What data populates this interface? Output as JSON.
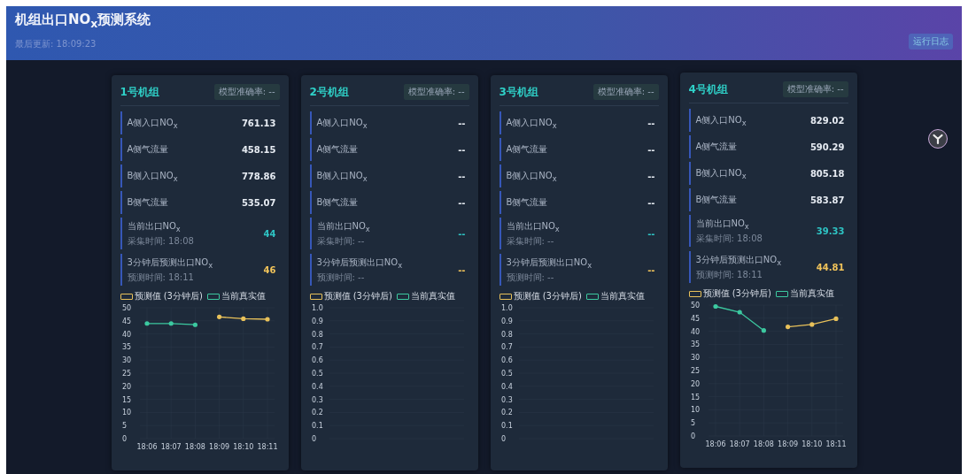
{
  "header": {
    "title": "机组出口NO$_{x}$预测系统",
    "updated": "最后更新: 18:09:23",
    "button": "运行日志"
  },
  "units": [
    {
      "name": "1号机组",
      "accuracy": "模型准确率: --",
      "rows": [
        {
          "kind": "plain",
          "label": "A侧入口NO$_{x}$",
          "value": "761.13"
        },
        {
          "kind": "plain",
          "label": "A侧气流量",
          "value": "458.15"
        },
        {
          "kind": "plain",
          "label": "B侧入口NO$_{x}$",
          "value": "778.86"
        },
        {
          "kind": "plain",
          "label": "B侧气流量",
          "value": "535.07"
        },
        {
          "kind": "current",
          "label": "当前出口NO$_{x}$",
          "sub": "采集时间: 18:08",
          "value": "44"
        },
        {
          "kind": "predicted",
          "label": "3分钟后预测出口NO$_{x}$",
          "sub": "预测时间: 18:11",
          "value": "46"
        }
      ],
      "chart_data": {
        "type": "line",
        "grid": true,
        "legend": "top",
        "categories": [
          "18:06",
          "18:07",
          "18:08",
          "18:09",
          "18:10",
          "18:11"
        ],
        "ylim": [
          0,
          50
        ],
        "yticks": [
          0,
          5,
          10,
          15,
          20,
          25,
          30,
          35,
          40,
          45,
          50
        ],
        "series": [
          {
            "name": "预测值 (3分钟后)",
            "color": "#e8c15a",
            "values": [
              null,
              null,
              null,
              46.5,
              45.8,
              45.6
            ]
          },
          {
            "name": "当前真实值",
            "color": "#3cc9a0",
            "values": [
              44,
              44,
              43.5,
              null,
              null,
              null
            ]
          }
        ]
      }
    },
    {
      "name": "2号机组",
      "accuracy": "模型准确率: --",
      "rows": [
        {
          "kind": "plain",
          "label": "A侧入口NO$_{x}$",
          "value": "--"
        },
        {
          "kind": "plain",
          "label": "A侧气流量",
          "value": "--"
        },
        {
          "kind": "plain",
          "label": "B侧入口NO$_{x}$",
          "value": "--"
        },
        {
          "kind": "plain",
          "label": "B侧气流量",
          "value": "--"
        },
        {
          "kind": "current",
          "label": "当前出口NO$_{x}$",
          "sub": "采集时间: --",
          "value": "--"
        },
        {
          "kind": "predicted",
          "label": "3分钟后预测出口NO$_{x}$",
          "sub": "预测时间: --",
          "value": "--"
        }
      ],
      "chart_data": {
        "type": "line",
        "grid": true,
        "legend": "top",
        "ylim": [
          0,
          1
        ],
        "yticks": [
          0,
          0.1,
          0.2,
          0.3,
          0.4,
          0.5,
          0.6,
          0.7,
          0.8,
          0.9,
          {
            "value": 1,
            "label": "1.0"
          }
        ],
        "series": [
          {
            "name": "预测值 (3分钟后)",
            "color": "#e8c15a"
          },
          {
            "name": "当前真实值",
            "color": "#3cc9a0"
          }
        ]
      }
    },
    {
      "name": "3号机组",
      "accuracy": "模型准确率: --",
      "rows": [
        {
          "kind": "plain",
          "label": "A侧入口NO$_{x}$",
          "value": "--"
        },
        {
          "kind": "plain",
          "label": "A侧气流量",
          "value": "--"
        },
        {
          "kind": "plain",
          "label": "B侧入口NO$_{x}$",
          "value": "--"
        },
        {
          "kind": "plain",
          "label": "B侧气流量",
          "value": "--"
        },
        {
          "kind": "current",
          "label": "当前出口NO$_{x}$",
          "sub": "采集时间: --",
          "value": "--"
        },
        {
          "kind": "predicted",
          "label": "3分钟后预测出口NO$_{x}$",
          "sub": "预测时间: --",
          "value": "--"
        }
      ],
      "chart_data": {
        "type": "line",
        "grid": true,
        "legend": "top",
        "ylim": [
          0,
          1
        ],
        "yticks": [
          0,
          0.1,
          0.2,
          0.3,
          0.4,
          0.5,
          0.6,
          0.7,
          0.8,
          0.9,
          {
            "value": 1,
            "label": "1.0"
          }
        ],
        "series": [
          {
            "name": "预测值 (3分钟后)",
            "color": "#e8c15a"
          },
          {
            "name": "当前真实值",
            "color": "#3cc9a0"
          }
        ]
      }
    },
    {
      "name": "4号机组",
      "accuracy": "模型准确率: --",
      "rows": [
        {
          "kind": "plain",
          "label": "A侧入口NO$_{x}$",
          "value": "829.02"
        },
        {
          "kind": "plain",
          "label": "A侧气流量",
          "value": "590.29"
        },
        {
          "kind": "plain",
          "label": "B侧入口NO$_{x}$",
          "value": "805.18"
        },
        {
          "kind": "plain",
          "label": "B侧气流量",
          "value": "583.87"
        },
        {
          "kind": "current",
          "label": "当前出口NO$_{x}$",
          "sub": "采集时间: 18:08",
          "value": "39.33"
        },
        {
          "kind": "predicted",
          "label": "3分钟后预测出口NO$_{x}$",
          "sub": "预测时间: 18:11",
          "value": "44.81"
        }
      ],
      "chart_data": {
        "type": "line",
        "grid": true,
        "legend": "top",
        "categories": [
          "18:06",
          "18:07",
          "18:08",
          "18:09",
          "18:10",
          "18:11"
        ],
        "ylim": [
          0,
          50
        ],
        "yticks": [
          0,
          5,
          10,
          15,
          20,
          25,
          30,
          35,
          40,
          45,
          50
        ],
        "series": [
          {
            "name": "预测值 (3分钟后)",
            "color": "#e8c15a",
            "values": [
              null,
              null,
              null,
              41.7,
              42.6,
              44.8
            ]
          },
          {
            "name": "当前真实值",
            "color": "#3cc9a0",
            "values": [
              49.5,
              47.3,
              40.3,
              null,
              null,
              null
            ]
          }
        ]
      }
    }
  ]
}
